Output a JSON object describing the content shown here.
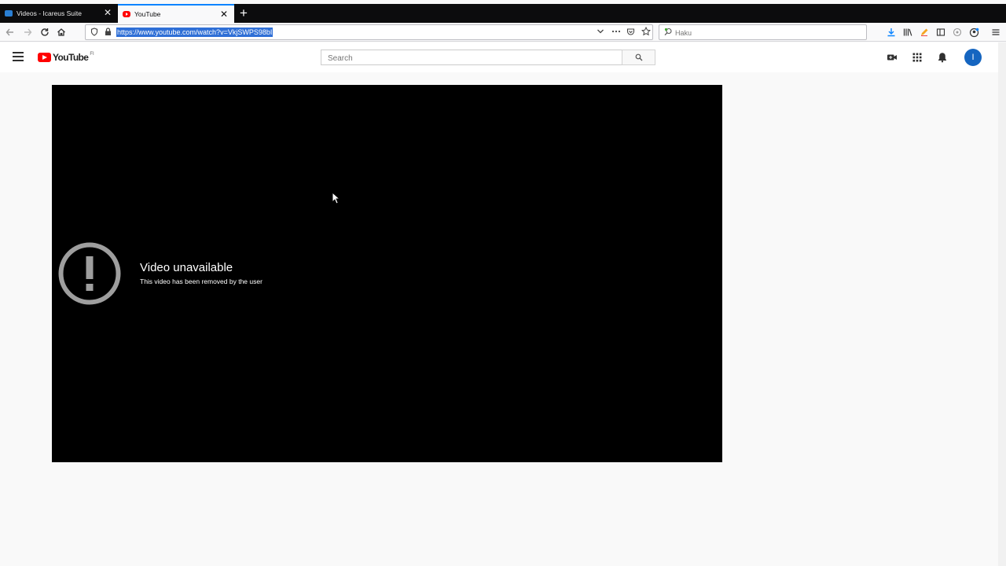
{
  "browser": {
    "tabs": [
      {
        "title": "Videos - Icareus Suite",
        "active": false,
        "favicon": "icareus-favicon"
      },
      {
        "title": "YouTube",
        "active": true,
        "favicon": "youtube-favicon"
      }
    ],
    "new_tab_label": "+",
    "url": "https://www.youtube.com/watch?v=VkjSWPS98bI",
    "search_placeholder": "Haku",
    "accent_color": "#0a84ff"
  },
  "youtube": {
    "logo_text": "YouTube",
    "country_code": "FI",
    "search_placeholder": "Search",
    "avatar_letter": "I",
    "header_icons": [
      "create-video-icon",
      "apps-grid-icon",
      "notifications-bell-icon"
    ],
    "brand_color": "#ff0000"
  },
  "player": {
    "error_title": "Video unavailable",
    "error_reason": "This video has been removed by the user"
  }
}
